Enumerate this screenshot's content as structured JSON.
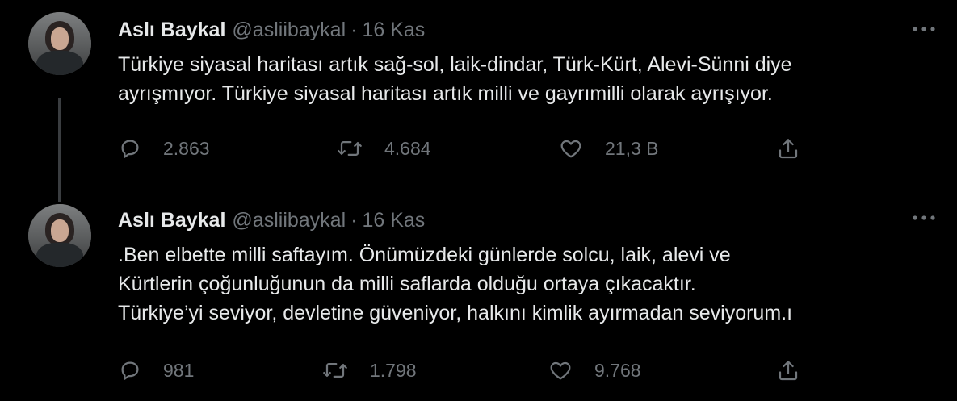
{
  "tweets": [
    {
      "author_name": "Aslı Baykal",
      "handle": "@asliibaykal",
      "separator": "·",
      "date": "16 Kas",
      "text_lines": [
        "Türkiye siyasal haritası artık sağ-sol, laik-dindar, Türk-Kürt, Alevi-Sünni diye",
        "ayrışmıyor. Türkiye siyasal haritası artık milli ve gayrımilli olarak ayrışıyor."
      ],
      "replies": "2.863",
      "retweets": "4.684",
      "likes": "21,3 B"
    },
    {
      "author_name": "Aslı Baykal",
      "handle": "@asliibaykal",
      "separator": "·",
      "date": "16 Kas",
      "text_lines": [
        ".Ben elbette milli saftayım. Önümüzdeki günlerde solcu, laik, alevi ve",
        "Kürtlerin çoğunluğunun da milli saflarda olduğu ortaya çıkacaktır.",
        "Türkiye’yi seviyor, devletine güveniyor, halkını kimlik ayırmadan seviyorum.ı"
      ],
      "replies": "981",
      "retweets": "1.798",
      "likes": "9.768"
    }
  ],
  "icons": {
    "reply": "reply-icon",
    "retweet": "retweet-icon",
    "like": "heart-icon",
    "share": "share-icon",
    "more": "more-icon"
  },
  "colors": {
    "background": "#000000",
    "text_primary": "#e7e9ea",
    "text_secondary": "#71767b",
    "thread_line": "#3a3d40"
  }
}
